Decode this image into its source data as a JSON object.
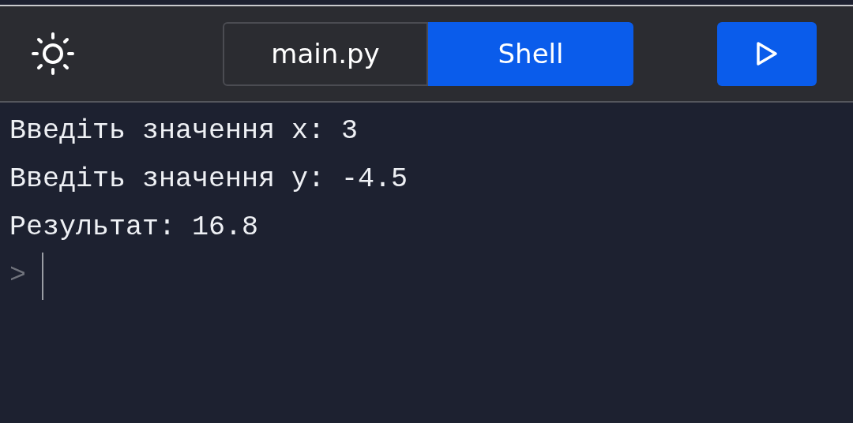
{
  "tabs": [
    {
      "label": "main.py",
      "selected": false
    },
    {
      "label": "Shell",
      "selected": true
    }
  ],
  "console": {
    "lines": [
      "Введіть значення x: 3",
      "Введіть значення y: -4.5",
      "Результат: 16.8"
    ],
    "prompt": ">"
  }
}
